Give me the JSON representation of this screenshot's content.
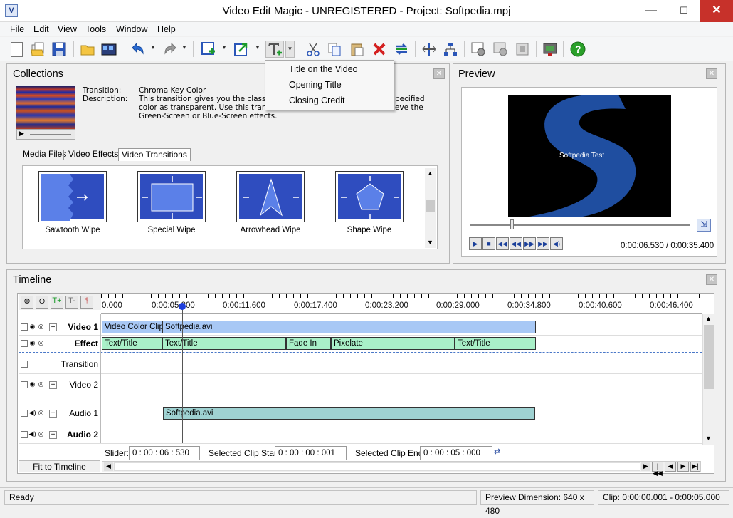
{
  "window": {
    "title": "Video Edit Magic - UNREGISTERED - Project: Softpedia.mpj",
    "minimize": "—",
    "maximize": "☐",
    "close": "✕"
  },
  "menu": [
    "File",
    "Edit",
    "View",
    "Tools",
    "Window",
    "Help"
  ],
  "toolbar_icons": [
    "new-icon",
    "open-icon",
    "save-icon",
    "open-folder-icon",
    "import-media-icon",
    "undo-icon",
    "redo-icon",
    "add-clip-icon",
    "export-icon",
    "text-title-icon",
    "cut-icon",
    "copy-icon",
    "paste-icon",
    "delete-icon",
    "replace-icon",
    "split-icon",
    "group-icon",
    "settings-icon",
    "render-icon",
    "crop-icon",
    "capture-icon",
    "help-icon"
  ],
  "text_dropdown": {
    "items": [
      "Title on the Video",
      "Opening Title",
      "Closing Credit"
    ]
  },
  "collections": {
    "title": "Collections",
    "transition_label": "Transition:",
    "transition_value": "Chroma Key Color",
    "description_label": "Description:",
    "description_lines": [
      "This transition gives you the classi",
      "color as transparent. Use this trans",
      "Green-Screen or Blue-Screen effects."
    ],
    "description_right": [
      "pecified",
      "eve the"
    ],
    "tabs": [
      "Media Files",
      "Video Effects",
      "Video Transitions"
    ],
    "active_tab": "Video Transitions",
    "items": [
      "Sawtooth Wipe",
      "Special Wipe",
      "Arrowhead Wipe",
      "Shape Wipe"
    ]
  },
  "preview": {
    "title": "Preview",
    "overlay_text": "Softpedia Test",
    "time": "0:00:06.530 / 0:00:35.400"
  },
  "timeline": {
    "title": "Timeline",
    "ruler": [
      "0.000",
      "0:00:05.800",
      "0:00:11.600",
      "0:00:17.400",
      "0:00:23.200",
      "0:00:29.000",
      "0:00:34.800",
      "0:00:40.600",
      "0:00:46.400"
    ],
    "tracks": [
      "Video 1",
      "Effect",
      "Transition",
      "Video 2",
      "Audio 1",
      "Audio 2"
    ],
    "clips": {
      "v1a": "Video Color Clip",
      "v1b": "Softpedia.avi",
      "e1": "Text/Title",
      "e2": "Text/Title",
      "e3": "Fade In",
      "e4": "Pixelate",
      "e5": "Text/Title",
      "a1": "Softpedia.avi"
    },
    "slider_label": "Slider:",
    "slider_value": "0 : 00 : 06 : 530",
    "clip_start_label": "Selected Clip Start:",
    "clip_start_value": "0 : 00 : 00 : 001",
    "clip_end_label": "Selected Clip End:",
    "clip_end_value": "0 : 00 : 05 : 000",
    "fit_label": "Fit to Timeline"
  },
  "status": {
    "ready": "Ready",
    "dimension": "Preview Dimension: 640 x 480",
    "clip": "Clip: 0:00:00.001 - 0:00:05.000"
  },
  "colors": {
    "accent": "#2f4dbf",
    "video_clip": "#a8c8f5",
    "effect_clip": "#a9f0c8",
    "audio_clip": "#9fd2d2",
    "playhead": "#1f3fdc"
  }
}
